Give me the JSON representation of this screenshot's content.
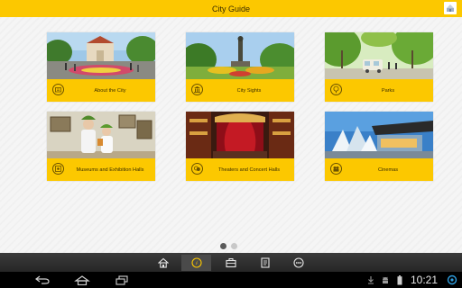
{
  "app": {
    "title": "City Guide",
    "accent_color": "#fcc800"
  },
  "tiles": [
    {
      "label": "About the City",
      "icon": "info-icon"
    },
    {
      "label": "City Sights",
      "icon": "landmark-icon"
    },
    {
      "label": "Parks",
      "icon": "tree-icon"
    },
    {
      "label": "Museums and Exhibition Halls",
      "icon": "museum-icon"
    },
    {
      "label": "Theaters and Concert Halls",
      "icon": "masks-icon"
    },
    {
      "label": "Cinemas",
      "icon": "film-icon"
    }
  ],
  "pager": {
    "pages": 2,
    "active_page": 1
  },
  "app_nav": {
    "items": [
      "home-icon",
      "compass-icon",
      "briefcase-icon",
      "notes-icon",
      "more-icon"
    ],
    "active_item": "compass-icon"
  },
  "system_bar": {
    "time": "10:21"
  }
}
